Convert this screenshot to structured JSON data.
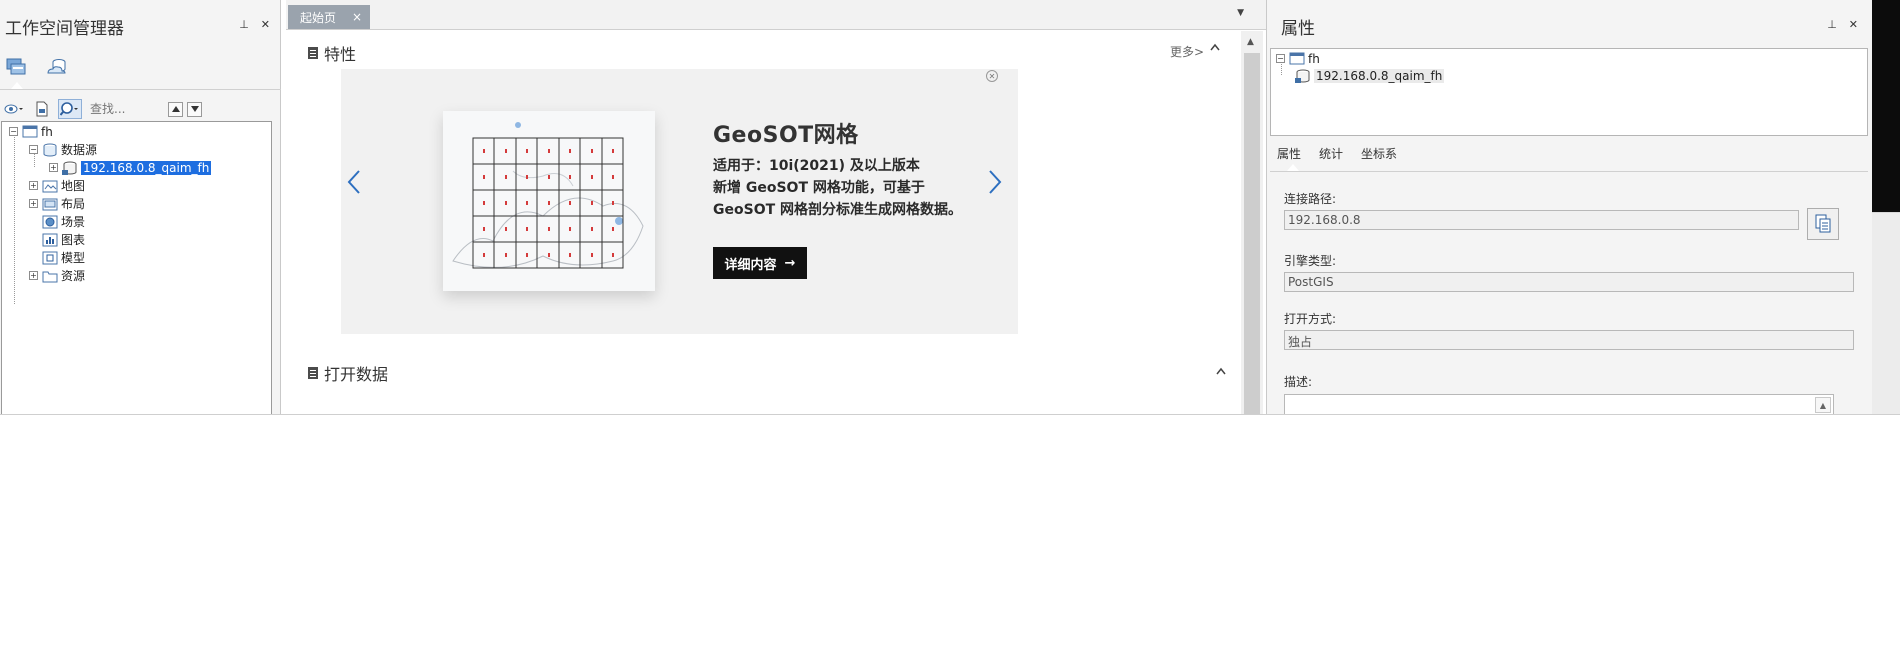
{
  "workspace": {
    "title": "工作空间管理器",
    "pin_glyph": "⊥",
    "close_glyph": "✕",
    "search_placeholder": "查找...",
    "tree": {
      "root": "fh",
      "datasource": "数据源",
      "datasource_item": "192.168.0.8_qaim_fh",
      "map": "地图",
      "layout": "布局",
      "scene": "场景",
      "chart": "图表",
      "model": "模型",
      "resource": "资源"
    }
  },
  "center": {
    "tab_label": "起始页",
    "tab_close": "×",
    "features_title": "特性",
    "more_label": "更多>",
    "banner": {
      "title": "GeoSOT网格",
      "line1": "适用于：10i(2021) 及以上版本",
      "line2": "新增 GeoSOT 网格功能，可基于",
      "line3": "GeoSOT 网格剖分标准生成网格数据。",
      "button": "详细内容",
      "button_arrow": "→"
    },
    "open_data_title": "打开数据"
  },
  "properties": {
    "title": "属性",
    "tree_root": "fh",
    "tree_item": "192.168.0.8_qaim_fh",
    "tabs": [
      "属性",
      "统计",
      "坐标系"
    ],
    "conn_label": "连接路径:",
    "conn_value": "192.168.0.8",
    "engine_label": "引擎类型:",
    "engine_value": "PostGIS",
    "open_label": "打开方式:",
    "open_value": "独占",
    "desc_label": "描述:"
  }
}
